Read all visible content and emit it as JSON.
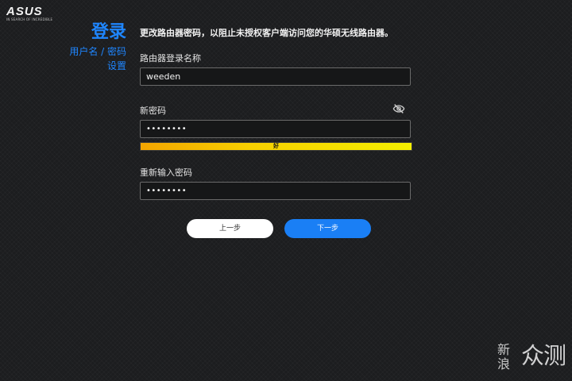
{
  "logo": {
    "brand": "ASUS",
    "tagline": "IN SEARCH OF INCREDIBLE"
  },
  "sidebar": {
    "title": "登录",
    "subtitle_line1": "用户名 / 密码",
    "subtitle_line2": "设置"
  },
  "description": "更改路由器密码，以阻止未授权客户端访问您的华硕无线路由器。",
  "form": {
    "login_name_label": "路由器登录名称",
    "login_name_value": "weeden",
    "new_password_label": "新密码",
    "new_password_value": "••••••••",
    "eye_icon": "eye-slash-icon",
    "strength_text": "好",
    "strength_level": 1.0,
    "confirm_password_label": "重新输入密码",
    "confirm_password_value": "••••••••"
  },
  "buttons": {
    "prev": "上一步",
    "next": "下一步"
  },
  "watermark": {
    "left": "新\n浪",
    "right": "众测"
  },
  "colors": {
    "accent": "#1f86ff",
    "background": "#1c1d1f",
    "strength_start": "#f3a500",
    "strength_end": "#f4ef00"
  }
}
